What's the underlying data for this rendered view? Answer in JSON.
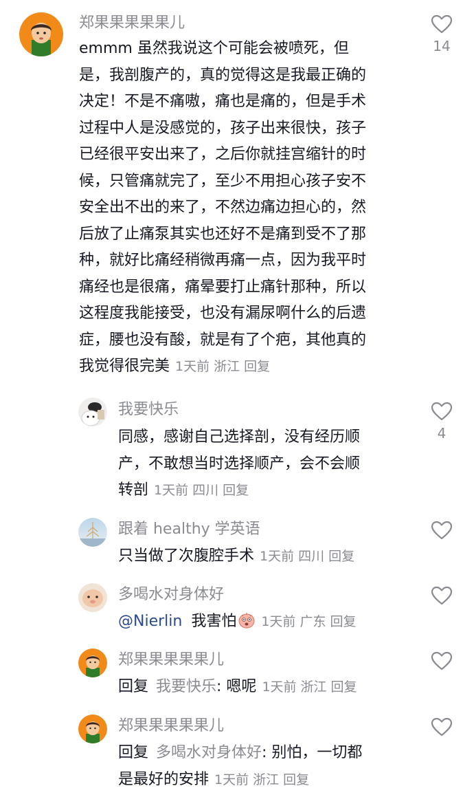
{
  "main_comment": {
    "username": "郑果果果果果儿",
    "lines": [
      "emmm 虽然我说这个可能会被喷死，但",
      "是，我剖腹产的，真的觉得这是我最正确的",
      "决定！不是不痛嗷，痛也是痛的，但是手术",
      "过程中人是没感觉的，孩子出来很快，孩子",
      "已经很平安出来了，之后你就挂宫缩针的时",
      "候，只管痛就完了，至少不用担心孩子安不",
      "安全出不出的来了，不然边痛边担心的，然",
      "后放了止痛泵其实也还好不是痛到受不了那",
      "种，就好比痛经稍微再痛一点，因为我平时",
      "痛经也是很痛，痛晕要打止痛针那种，所以",
      "这程度我能接受，也没有漏尿啊什么的后遗",
      "症，腰也没有酸，就是有了个疤，其他真的"
    ],
    "last_line": "我觉得很完美",
    "time": "1天前",
    "location": "浙江",
    "reply_label": "回复",
    "likes": "14"
  },
  "replies": [
    {
      "username": "我要快乐",
      "lines": [
        "同感，感谢自己选择剖，没有经历顺",
        "产，不敢想当时选择顺产，会不会顺"
      ],
      "last_line": "转剖",
      "time": "1天前",
      "location": "四川",
      "reply_label": "回复",
      "likes": "4"
    },
    {
      "username": "跟着 healthy 学英语",
      "last_line": "只当做了次腹腔手术",
      "time": "1天前",
      "location": "四川",
      "reply_label": "回复"
    },
    {
      "username": "多喝水对身体好",
      "mention": "@Nierlin",
      "last_line": "我害怕",
      "emoji": "scared-face-icon",
      "time": "1天前",
      "location": "广东",
      "reply_label": "回复"
    },
    {
      "username": "郑果果果果果儿",
      "reply_prefix": "回复",
      "reply_to": "我要快乐",
      "last_line": ": 嗯呢",
      "time": "1天前",
      "location": "浙江",
      "reply_label": "回复"
    },
    {
      "username": "郑果果果果果儿",
      "reply_prefix": "回复",
      "reply_to": "多喝水对身体好",
      "first_line_rest": ": 别怕，一切都",
      "last_line": "是最好的安排",
      "time": "1天前",
      "location": "浙江",
      "reply_label": "回复"
    }
  ],
  "colors": {
    "text": "#161823",
    "muted": "#8a8b91",
    "mention": "#2b4a8e",
    "heart_stroke": "#8a8b91"
  }
}
